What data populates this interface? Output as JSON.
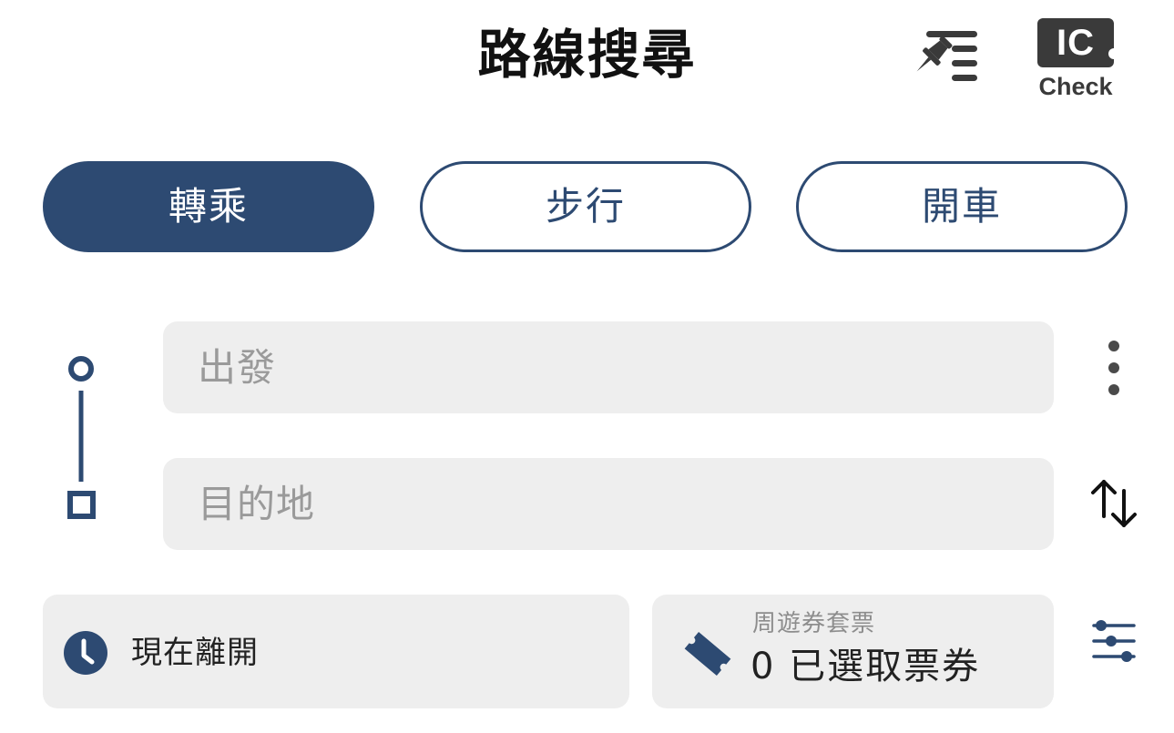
{
  "header": {
    "title": "路線搜尋",
    "pin_list_icon": "pin-list-icon",
    "ic_check": {
      "box_text": "IC",
      "caption": "Check"
    }
  },
  "modes": [
    {
      "label": "轉乘",
      "active": true
    },
    {
      "label": "步行",
      "active": false
    },
    {
      "label": "開車",
      "active": false
    }
  ],
  "route": {
    "origin_placeholder": "出發",
    "destination_placeholder": "目的地",
    "origin_value": "",
    "destination_value": ""
  },
  "options": {
    "depart_time_label": "現在離開",
    "pass_caption": "周遊券套票",
    "pass_selection": "0 已選取票券"
  },
  "colors": {
    "accent": "#2d4a72",
    "field_bg": "#eeeeee",
    "placeholder": "#9a9a9a"
  }
}
